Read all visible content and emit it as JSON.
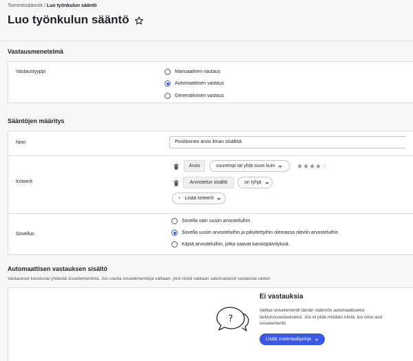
{
  "breadcrumb": {
    "parent": "Toimintosäännöt",
    "separator": " / ",
    "current": "Luo työnkulun sääntö"
  },
  "page": {
    "title": "Luo työnkulun sääntö",
    "favorite_icon": "star-outline-icon"
  },
  "response_method": {
    "heading": "Vastausmenetelmä",
    "row_label": "Vastaustyyppi",
    "options": [
      {
        "label": "Manuaalinen vastaus",
        "selected": false
      },
      {
        "label": "Automaattinen vastaus",
        "selected": true
      },
      {
        "label": "Generatiivinen vastaus",
        "selected": false
      }
    ]
  },
  "rules": {
    "heading": "Sääntöjen määritys",
    "name": {
      "label": "Nimi",
      "value": "Positiivinen arvio ilman sisältöä"
    },
    "criteria": {
      "label": "Kriteerit",
      "items": [
        {
          "field": "Arvio",
          "operator": "suurempi tai yhtä suuri kuin",
          "rating_value": 4,
          "rating_max": 5
        },
        {
          "field": "Arvostelun sisältö",
          "operator": "on tyhjä"
        }
      ],
      "add_label": "Lisää kriteerit"
    },
    "apply": {
      "label": "Sovellus",
      "options": [
        {
          "label": "Sovella vain uusiin arvosteluihin",
          "selected": false
        },
        {
          "label": "Sovella uusiin arvosteluihin ja päivitettyihin olemassa oleviin arvosteluihin",
          "selected": true
        },
        {
          "label": "Käytä arvosteluihin, jotka saavat kansiopäivityksiä",
          "selected": false
        }
      ]
    }
  },
  "auto_content": {
    "heading": "Automaattisen vastauksen sisältö",
    "description": "Vastaukset koostuvat yhdestä sivuelementistä. Jos useita sivuelementtejä valitaan, yksi niistä valitaan satunnaisesti vastausta varten",
    "empty": {
      "title": "Ei vastauksia",
      "text": "Valitse sivuelementit tämän säännön automaattiseksi tarkistusvastaukseksi. Jos et pidä mistään niistä, luo oma uusi sivuelementti.",
      "button_label": "Lisää materiaalipohja",
      "illustration_icon": "question-speech-bubbles-icon"
    }
  },
  "colors": {
    "accent": "#3858e9",
    "background": "#f6f7f7",
    "border": "#dcdcde"
  }
}
